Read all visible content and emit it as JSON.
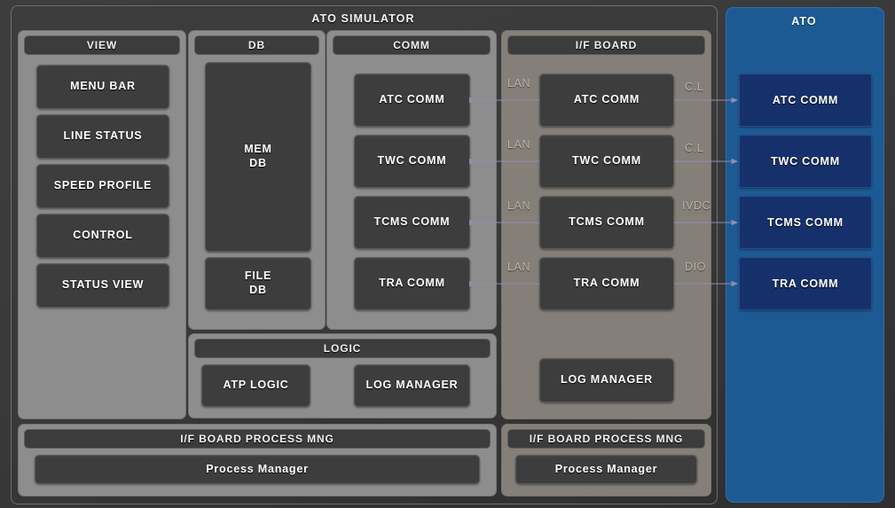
{
  "diagram": {
    "title": "ATO SIMULATOR",
    "background_color": "#3b3b3b",
    "panel_color": "#8d8d8d",
    "box_color": "#3d3d3d",
    "accent_color": "#1d5a94",
    "ato_box_color": "#16306b",
    "arrow_color": "#8f8fae"
  },
  "simulator": {
    "title": "ATO SIMULATOR",
    "view": {
      "header": "VIEW",
      "items": [
        {
          "label": "MENU BAR"
        },
        {
          "label": "LINE STATUS"
        },
        {
          "label": "SPEED PROFILE"
        },
        {
          "label": "CONTROL"
        },
        {
          "label": "STATUS VIEW"
        }
      ]
    },
    "db": {
      "header": "DB",
      "items": [
        {
          "label": "MEM\nDB"
        },
        {
          "label": "FILE\nDB"
        }
      ]
    },
    "comm": {
      "header": "COMM",
      "items": [
        {
          "label": "ATC COMM"
        },
        {
          "label": "TWC COMM"
        },
        {
          "label": "TCMS COMM"
        },
        {
          "label": "TRA COMM"
        }
      ]
    },
    "logic": {
      "header": "LOGIC",
      "items": [
        {
          "label": "ATP LOGIC"
        },
        {
          "label": "LOG MANAGER"
        }
      ]
    },
    "process_mng": {
      "header": "I/F BOARD PROCESS MNG",
      "items": [
        {
          "label": "Process Manager"
        }
      ]
    }
  },
  "ifboard": {
    "header": "I/F BOARD",
    "items": [
      {
        "label": "ATC COMM"
      },
      {
        "label": "TWC COMM"
      },
      {
        "label": "TCMS COMM"
      },
      {
        "label": "TRA COMM"
      },
      {
        "label": "LOG MANAGER"
      }
    ],
    "process_mng": {
      "header": "I/F BOARD PROCESS MNG",
      "items": [
        {
          "label": "Process Manager"
        }
      ]
    }
  },
  "ato": {
    "title": "ATO",
    "items": [
      {
        "label": "ATC COMM"
      },
      {
        "label": "TWC COMM"
      },
      {
        "label": "TCMS COMM"
      },
      {
        "label": "TRA COMM"
      }
    ]
  },
  "links": {
    "left": [
      {
        "label": "LAN"
      },
      {
        "label": "LAN"
      },
      {
        "label": "LAN"
      },
      {
        "label": "LAN"
      }
    ],
    "right": [
      {
        "label": "C.L"
      },
      {
        "label": "C.L"
      },
      {
        "label": "IVDC"
      },
      {
        "label": "DIO"
      }
    ]
  }
}
